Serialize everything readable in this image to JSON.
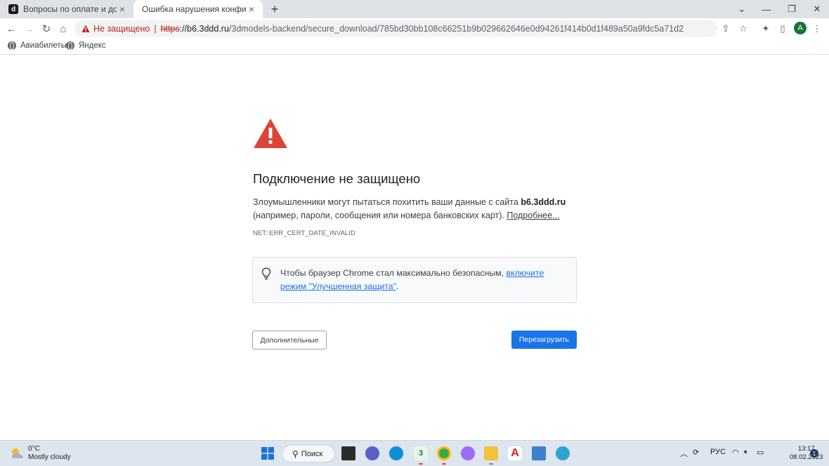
{
  "tabs": [
    {
      "title": "Вопросы по оплате и доступам",
      "favicon_letter": "d"
    },
    {
      "title": "Ошибка нарушения конфиденциальности"
    }
  ],
  "omnibox": {
    "security_label": "Не защищено",
    "separator": "|",
    "scheme": "https",
    "host": "://b6.3ddd.ru",
    "path": "/3dmodels-backend/secure_download/785bd30bb108c66251b9b029662646e0d94261f414b0d1f489a50a9fdc5a71d2"
  },
  "profile": {
    "initial": "A"
  },
  "bookmarks": [
    {
      "label": "Авиабилеты"
    },
    {
      "label": "Яндекс"
    }
  ],
  "interstitial": {
    "heading": "Подключение не защищено",
    "body_text": "Злоумышленники могут пытаться похитить ваши данные с сайта ",
    "host": "b6.3ddd.ru",
    "body_text2": "(например, пароли, сообщения или номера банковских карт). ",
    "details_link": "Подробнее...",
    "error_code": "NET::ERR_CERT_DATE_INVALID",
    "tip_text": "Чтобы браузер Chrome стал максимально безопасным, ",
    "tip_link": "включите режим \"Улучшенная защита\"",
    "tip_end": ".",
    "advanced_button": "Дополнительные",
    "reload_button": "Перезагрузить"
  },
  "taskbar": {
    "weather_temp": "0°C",
    "weather_desc": "Mostly cloudy",
    "search_label": "Поиск",
    "language": "РУС",
    "time": "13:17",
    "date": "08.02.2023",
    "notification_count": "1"
  },
  "colors": {
    "accent": "#1a73e8",
    "danger": "#c5221f",
    "warning_icon": "#db4437"
  }
}
